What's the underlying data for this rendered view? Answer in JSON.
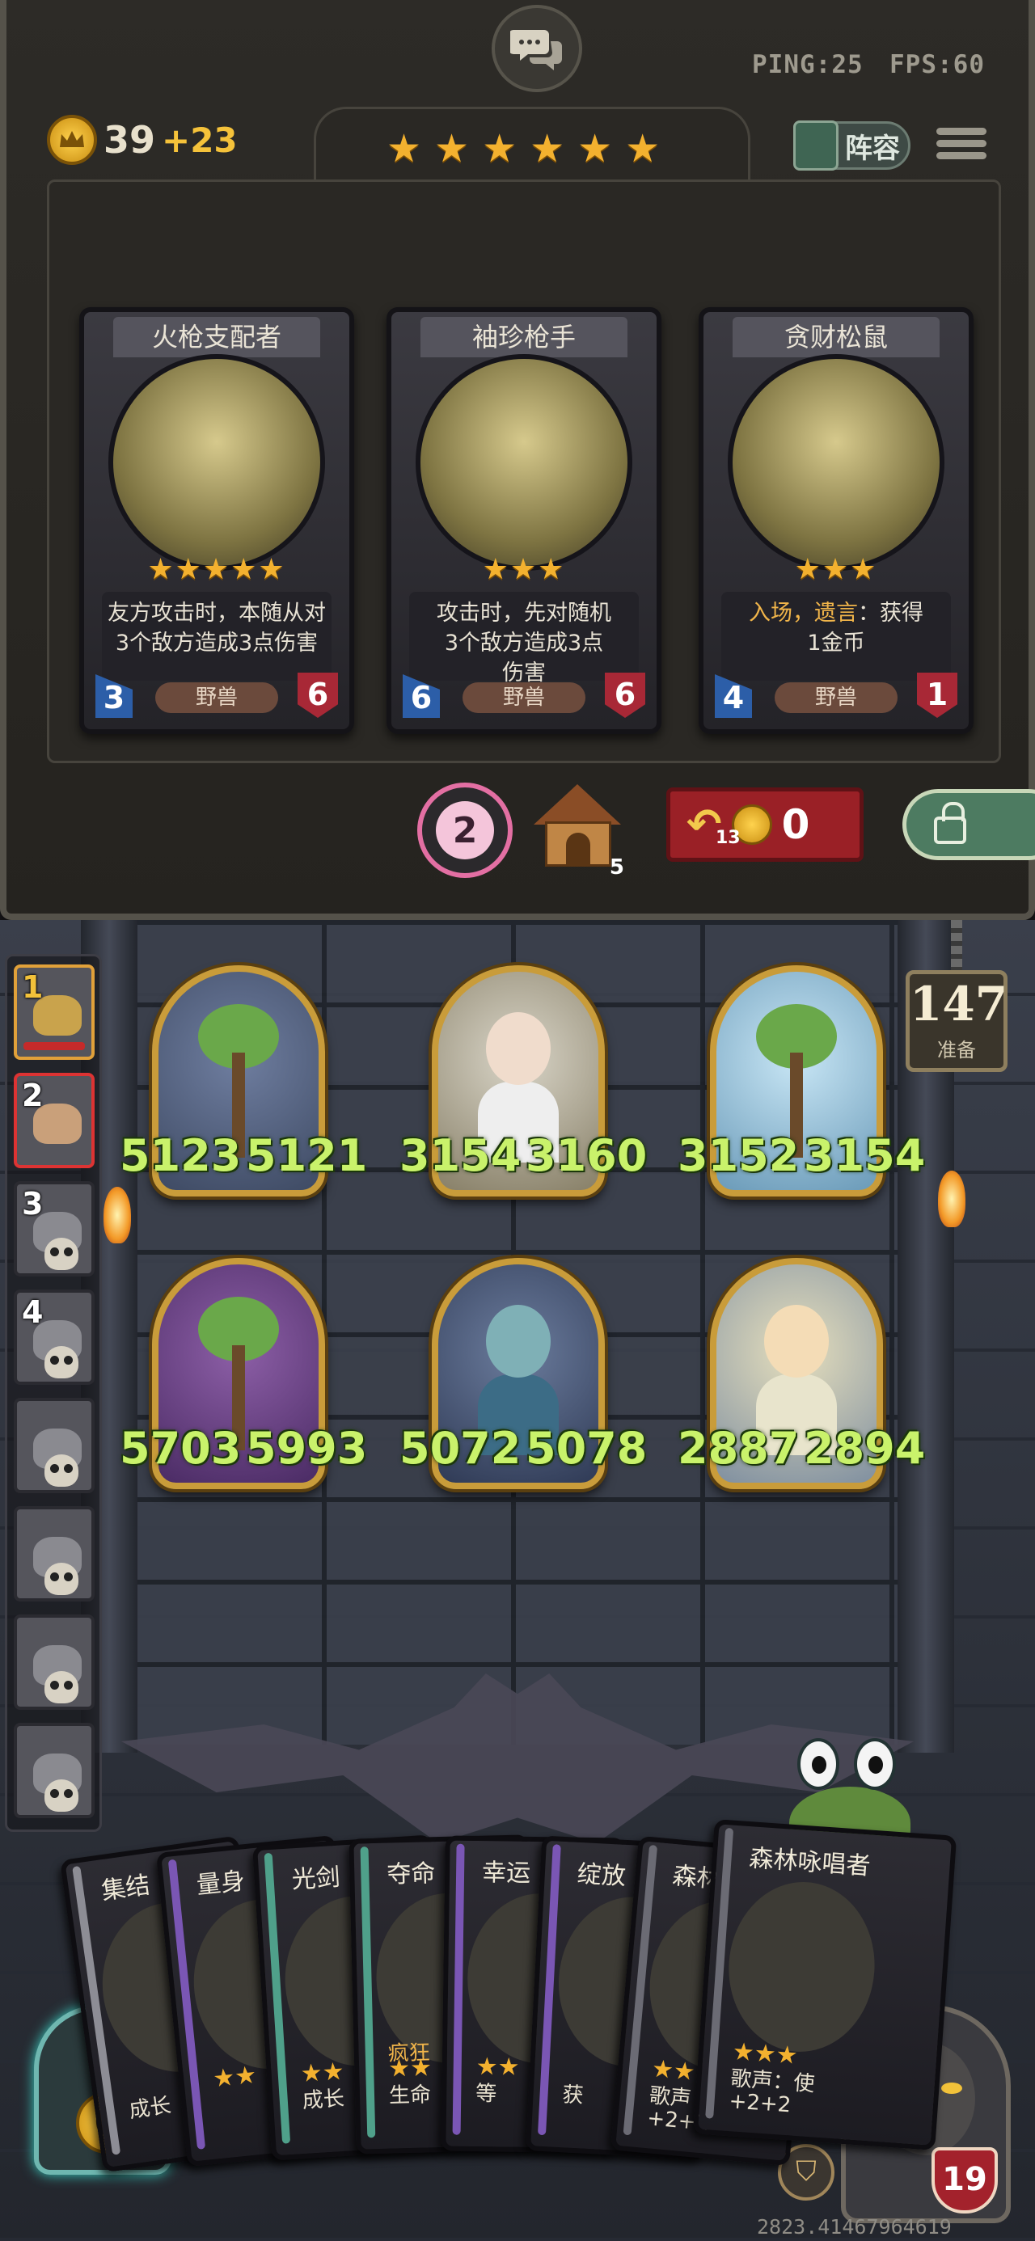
{
  "network": {
    "ping": "PING:25",
    "fps": "FPS:60"
  },
  "gold": {
    "amount": "39",
    "income": "+23"
  },
  "star_level": 6,
  "lineup_button": "阵容",
  "shop_cards": [
    {
      "name": "火枪支配者",
      "stars": "★★★★★",
      "desc": [
        {
          "t": "友方攻击时，本随从对"
        },
        {
          "t": "3个敌方造成3点伤害"
        }
      ],
      "tribe": "野兽",
      "attack": "3",
      "health": "6"
    },
    {
      "name": "袖珍枪手",
      "stars": "★★★",
      "desc": [
        {
          "t": "攻击时，先对随机"
        },
        {
          "t": "3个敌方造成3点"
        },
        {
          "t": "伤害"
        }
      ],
      "tribe": "野兽",
      "attack": "6",
      "health": "6"
    },
    {
      "name": "贪财松鼠",
      "stars": "★★★",
      "desc_hi": "入场，遗言",
      "desc_rest": "：获得",
      "desc_line2": "1金币",
      "tribe": "野兽",
      "attack": "4",
      "health": "1"
    }
  ],
  "favor_count": "2",
  "tavern_tier": "5",
  "refresh": {
    "count": "13",
    "cost": "0"
  },
  "prep": {
    "count": "147",
    "label": "准备"
  },
  "players": [
    {
      "rank": "1",
      "state": "active"
    },
    {
      "rank": "2",
      "state": "self"
    },
    {
      "rank": "3",
      "state": "dead"
    },
    {
      "rank": "4",
      "state": "dead"
    },
    {
      "rank": "",
      "state": "dead"
    },
    {
      "rank": "",
      "state": "dead"
    },
    {
      "rank": "",
      "state": "dead"
    },
    {
      "rank": "",
      "state": "dead"
    }
  ],
  "board": [
    {
      "kind": "tree1",
      "attack": "5123",
      "health": "5121"
    },
    {
      "kind": "girl",
      "attack": "3154",
      "health": "3160"
    },
    {
      "kind": "tree2",
      "attack": "3152",
      "health": "3154"
    },
    {
      "kind": "tree3",
      "attack": "5703",
      "health": "5993"
    },
    {
      "kind": "elf",
      "attack": "5072",
      "health": "5078"
    },
    {
      "kind": "fairy",
      "attack": "2887",
      "health": "2894"
    }
  ],
  "hand": [
    {
      "name": "集结",
      "color": "#8d8d95",
      "text": "成长",
      "stars": ""
    },
    {
      "name": "量身",
      "color": "#7a56b4",
      "text": "",
      "stars": "★★"
    },
    {
      "name": "光剑",
      "color": "#4fa08a",
      "text": "成长",
      "stars": "★★"
    },
    {
      "name": "夺命",
      "color": "#4fa08a",
      "text": "生命",
      "stars": "★★",
      "extra": "疯狂"
    },
    {
      "name": "幸运",
      "color": "#7a56b4",
      "text": "等",
      "stars": "★★"
    },
    {
      "name": "绽放",
      "color": "#7a56b4",
      "text": "获",
      "stars": ""
    },
    {
      "name": "森林",
      "color": "#6b6b74",
      "text": "歌声",
      "stars": "★★",
      "sub": "+2+2"
    },
    {
      "name": "森林咏唱者",
      "color": "#6b6b74",
      "text": "歌声：使",
      "stars": "★★★",
      "sub": "+2+2"
    }
  ],
  "chest_gold": "0",
  "hero_health": "19",
  "seed": "2823.41467964619",
  "colors": {
    "gold": "#f3b12f",
    "stat_green": "#c9f26b",
    "attack_blue": "#2c5ea8",
    "health_red": "#a82836"
  }
}
